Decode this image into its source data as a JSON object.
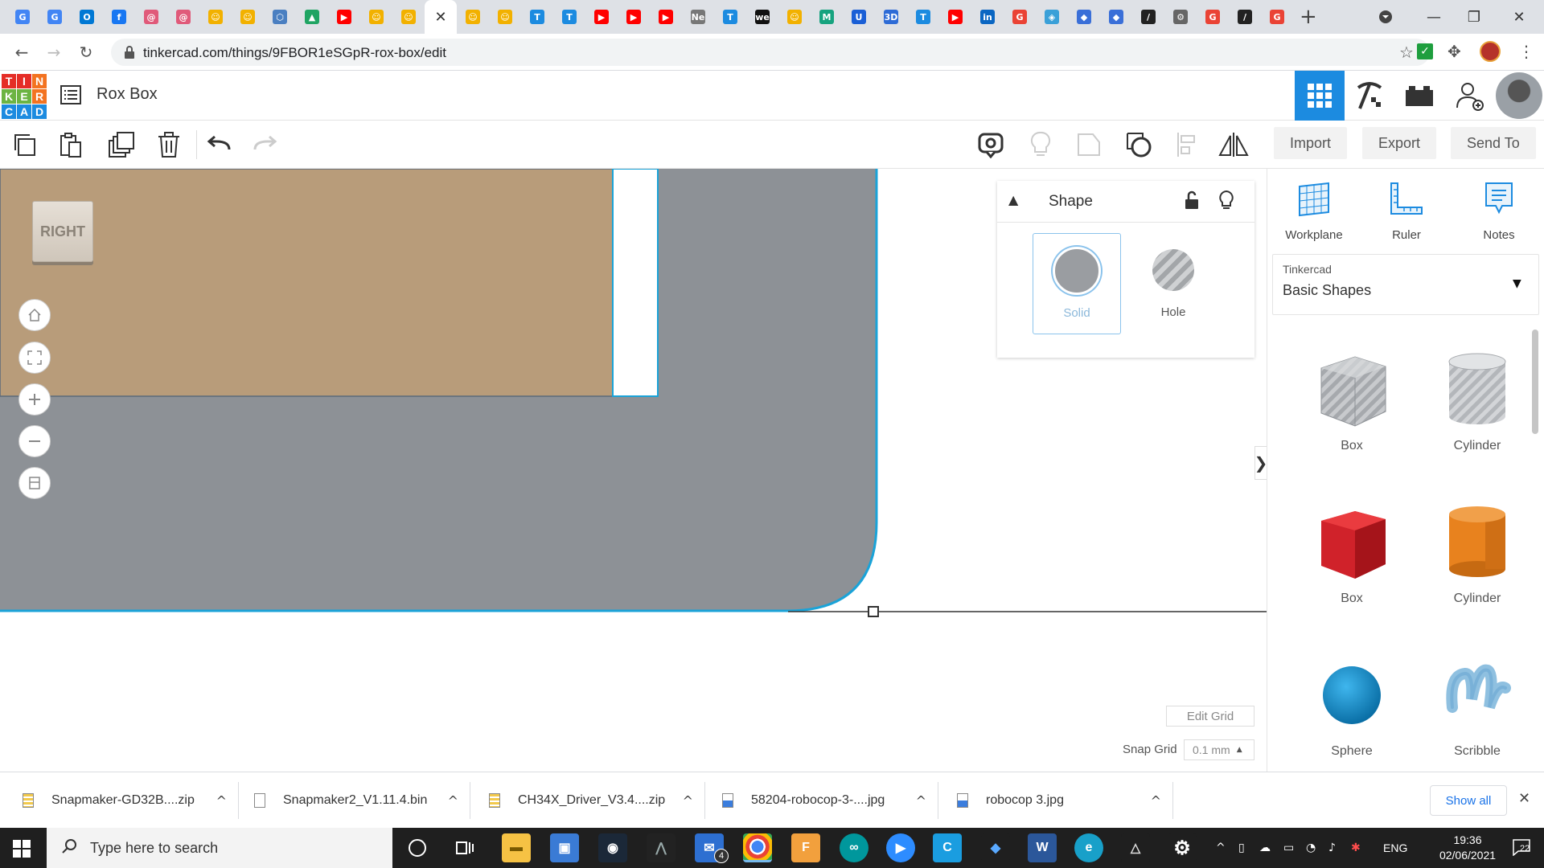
{
  "browser": {
    "tab_close_glyph": "✕",
    "new_tab_glyph": "+",
    "url": "tinkercad.com/things/9FBOR1eSGpR-rox-box/edit",
    "window_controls": {
      "minimize": "—",
      "maximize": "❐",
      "close": "✕"
    },
    "tabs": [
      {
        "icon": "google-ads-icon",
        "color": "#4285f4",
        "glyph": "G"
      },
      {
        "icon": "google-ads-icon",
        "color": "#4285f4",
        "glyph": "G"
      },
      {
        "icon": "outlook-icon",
        "color": "#0078d4",
        "glyph": "O"
      },
      {
        "icon": "facebook-icon",
        "color": "#1877f2",
        "glyph": "f"
      },
      {
        "icon": "spiral-icon",
        "color": "#e05a7a",
        "glyph": "@"
      },
      {
        "icon": "spiral-icon",
        "color": "#e05a7a",
        "glyph": "@"
      },
      {
        "icon": "instructables-robot-icon",
        "color": "#f2b100",
        "glyph": "☺"
      },
      {
        "icon": "instructables-robot-icon",
        "color": "#f2b100",
        "glyph": "☺"
      },
      {
        "icon": "hexagon-icon",
        "color": "#4a7fc1",
        "glyph": "⬡"
      },
      {
        "icon": "drive-icon",
        "color": "#1fa463",
        "glyph": "▲"
      },
      {
        "icon": "youtube-icon",
        "color": "#ff0000",
        "glyph": "▶"
      },
      {
        "icon": "instructables-robot-icon",
        "color": "#f2b100",
        "glyph": "☺"
      },
      {
        "icon": "instructables-robot-icon",
        "color": "#f2b100",
        "glyph": "☺"
      },
      {
        "icon": "active-tab-close",
        "color": "#ffffff",
        "glyph": "✕",
        "active": true
      },
      {
        "icon": "instructables-robot-icon",
        "color": "#f2b100",
        "glyph": "☺"
      },
      {
        "icon": "instructables-robot-icon",
        "color": "#f2b100",
        "glyph": "☺"
      },
      {
        "icon": "tinkercad-t-icon",
        "color": "#1c8be0",
        "glyph": "T"
      },
      {
        "icon": "tinkercad-t-icon",
        "color": "#1c8be0",
        "glyph": "T"
      },
      {
        "icon": "youtube-icon",
        "color": "#ff0000",
        "glyph": "▶"
      },
      {
        "icon": "youtube-icon",
        "color": "#ff0000",
        "glyph": "▶"
      },
      {
        "icon": "youtube-icon",
        "color": "#ff0000",
        "glyph": "▶"
      },
      {
        "icon": "netflix-icon",
        "color": "#777777",
        "glyph": "Ne"
      },
      {
        "icon": "tinkercad-t-icon",
        "color": "#1c8be0",
        "glyph": "T"
      },
      {
        "icon": "we-icon",
        "color": "#111111",
        "glyph": "we"
      },
      {
        "icon": "instructables-robot-icon",
        "color": "#f2b100",
        "glyph": "☺"
      },
      {
        "icon": "m-icon",
        "color": "#16a37f",
        "glyph": "M"
      },
      {
        "icon": "u-icon",
        "color": "#1a5fd6",
        "glyph": "U"
      },
      {
        "icon": "3d-icon",
        "color": "#2d6bd6",
        "glyph": "3D"
      },
      {
        "icon": "tinkercad-t-icon",
        "color": "#1c8be0",
        "glyph": "T"
      },
      {
        "icon": "youtube-icon",
        "color": "#ff0000",
        "glyph": "▶"
      },
      {
        "icon": "linkedin-icon",
        "color": "#0a66c2",
        "glyph": "in"
      },
      {
        "icon": "google-icon",
        "color": "#ea4335",
        "glyph": "G"
      },
      {
        "icon": "cube-icon",
        "color": "#3aa0d8",
        "glyph": "◈"
      },
      {
        "icon": "layers-icon",
        "color": "#3a6fd8",
        "glyph": "◆"
      },
      {
        "icon": "layers-icon",
        "color": "#3a6fd8",
        "glyph": "◆"
      },
      {
        "icon": "slash-icon",
        "color": "#222222",
        "glyph": "/"
      },
      {
        "icon": "robot-icon",
        "color": "#666666",
        "glyph": "⚙"
      },
      {
        "icon": "google-icon",
        "color": "#ea4335",
        "glyph": "G"
      },
      {
        "icon": "slash-icon",
        "color": "#222222",
        "glyph": "/"
      },
      {
        "icon": "google-icon",
        "color": "#ea4335",
        "glyph": "G"
      }
    ]
  },
  "app": {
    "logo_letters": [
      "T",
      "I",
      "N",
      "K",
      "E",
      "R",
      "C",
      "A",
      "D"
    ],
    "logo_colors": [
      "#e52d27",
      "#e52d27",
      "#f37321",
      "#6cb443",
      "#6cb443",
      "#f37321",
      "#1c8be0",
      "#1c8be0",
      "#1c8be0"
    ],
    "design_title": "Rox Box",
    "accent": "#1c8be0"
  },
  "toolbar": {
    "import_label": "Import",
    "export_label": "Export",
    "send_to_label": "Send To"
  },
  "viewcube": {
    "label": "RIGHT"
  },
  "inspector": {
    "title": "Shape",
    "solid_label": "Solid",
    "hole_label": "Hole"
  },
  "grid": {
    "edit_grid_label": "Edit Grid",
    "snap_grid_label": "Snap Grid",
    "snap_grid_value": "0.1 mm"
  },
  "right_panel": {
    "workplane_label": "Workplane",
    "ruler_label": "Ruler",
    "notes_label": "Notes",
    "library_caption": "Tinkercad",
    "library_value": "Basic Shapes",
    "shapes": [
      {
        "label": "Box",
        "kind": "box-hole",
        "color": "#b9bcc0"
      },
      {
        "label": "Cylinder",
        "kind": "cylinder-hole",
        "color": "#c8cbcf"
      },
      {
        "label": "Box",
        "kind": "box",
        "color": "#d0222a"
      },
      {
        "label": "Cylinder",
        "kind": "cylinder",
        "color": "#e8821e"
      },
      {
        "label": "Sphere",
        "kind": "sphere",
        "color": "#1a95d0"
      },
      {
        "label": "Scribble",
        "kind": "scribble",
        "color": "#8fc0e0"
      }
    ]
  },
  "downloads": {
    "items": [
      {
        "name": "Snapmaker-GD32B....zip",
        "icon": "zip-file-icon"
      },
      {
        "name": "Snapmaker2_V1.11.4.bin",
        "icon": "file-icon"
      },
      {
        "name": "CH34X_Driver_V3.4....zip",
        "icon": "zip-file-icon"
      },
      {
        "name": "58204-robocop-3-....jpg",
        "icon": "image-file-icon"
      },
      {
        "name": "robocop 3.jpg",
        "icon": "image-file-icon"
      }
    ],
    "show_all_label": "Show all"
  },
  "taskbar": {
    "search_placeholder": "Type here to search",
    "language": "ENG",
    "time": "19:36",
    "date": "02/06/2021",
    "notification_count": "22",
    "mail_badge": "4"
  }
}
